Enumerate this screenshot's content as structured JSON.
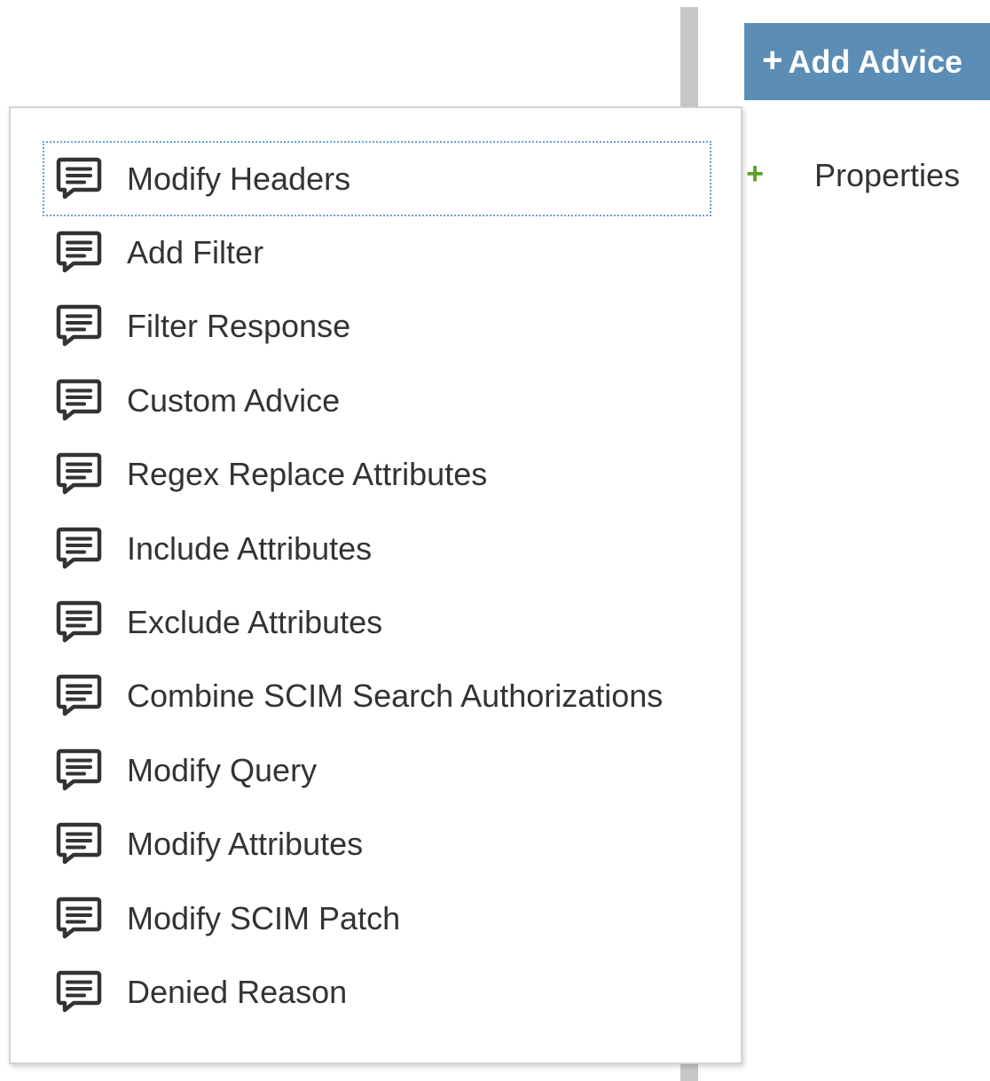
{
  "toolbar": {
    "add_advice_icon": "+",
    "add_advice_label": "Add Advice"
  },
  "properties": {
    "icon": "+",
    "label": "Properties"
  },
  "menu": {
    "icon_name": "comment-icon",
    "items": [
      {
        "label": "Modify Headers"
      },
      {
        "label": "Add Filter"
      },
      {
        "label": "Filter Response"
      },
      {
        "label": "Custom Advice"
      },
      {
        "label": "Regex Replace Attributes"
      },
      {
        "label": "Include Attributes"
      },
      {
        "label": "Exclude Attributes"
      },
      {
        "label": "Combine SCIM Search Authorizations"
      },
      {
        "label": "Modify Query"
      },
      {
        "label": "Modify Attributes"
      },
      {
        "label": "Modify SCIM Patch"
      },
      {
        "label": "Denied Reason"
      }
    ]
  },
  "colors": {
    "button_bg": "#5b8db5",
    "button_text": "#ffffff",
    "green_plus": "#5aa025",
    "text": "#333333",
    "focus_outline": "#6a9fd4",
    "divider": "#c8c8c8"
  }
}
